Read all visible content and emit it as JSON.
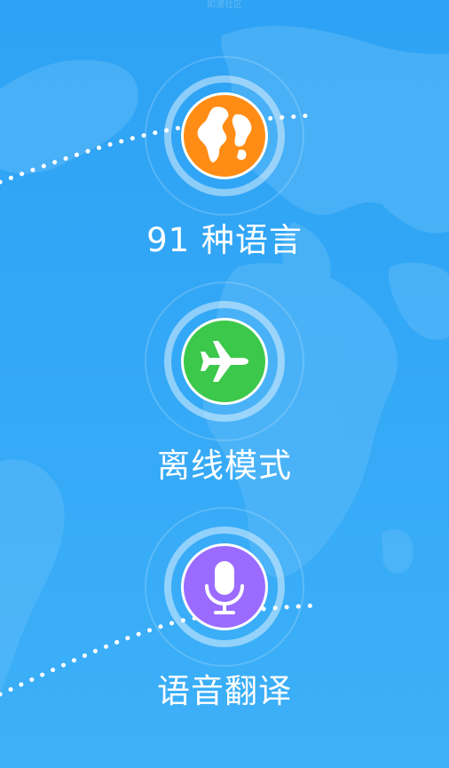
{
  "watermark": "如漫社区",
  "features": [
    {
      "label": "91 种语言",
      "icon": "globe-icon",
      "color": "#FF8C14"
    },
    {
      "label": "离线模式",
      "icon": "airplane-icon",
      "color": "#3CC84A"
    },
    {
      "label": "语音翻译",
      "icon": "microphone-icon",
      "color": "#9B6BFF"
    }
  ]
}
